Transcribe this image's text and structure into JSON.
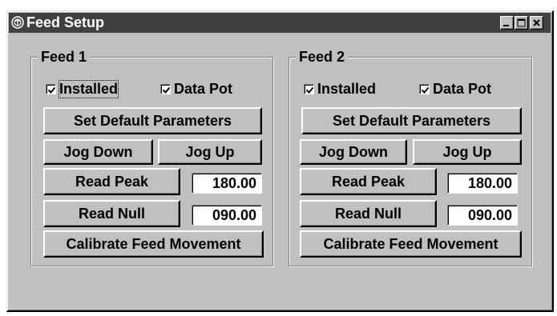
{
  "window": {
    "title": "Feed Setup",
    "icon": "app-emblem-icon",
    "controls": [
      "minimize-icon",
      "maximize-icon",
      "close-icon"
    ]
  },
  "feeds": [
    {
      "label": "Feed 1",
      "installed": {
        "label": "Installed",
        "checked": true
      },
      "data_pot": {
        "label": "Data Pot",
        "checked": true
      },
      "set_default_label": "Set Default Parameters",
      "jog_down_label": "Jog Down",
      "jog_up_label": "Jog Up",
      "read_peak_label": "Read Peak",
      "peak_value": "180.00",
      "read_null_label": "Read Null",
      "null_value": "090.00",
      "calibrate_label": "Calibrate Feed Movement"
    },
    {
      "label": "Feed 2",
      "installed": {
        "label": "Installed",
        "checked": true
      },
      "data_pot": {
        "label": "Data Pot",
        "checked": true
      },
      "set_default_label": "Set Default Parameters",
      "jog_down_label": "Jog Down",
      "jog_up_label": "Jog Up",
      "read_peak_label": "Read Peak",
      "peak_value": "180.00",
      "read_null_label": "Read Null",
      "null_value": "090.00",
      "calibrate_label": "Calibrate Feed Movement"
    }
  ],
  "colors": {
    "face": "#c0c0c0",
    "title_bar": "#404040",
    "title_text": "#ffffff"
  }
}
